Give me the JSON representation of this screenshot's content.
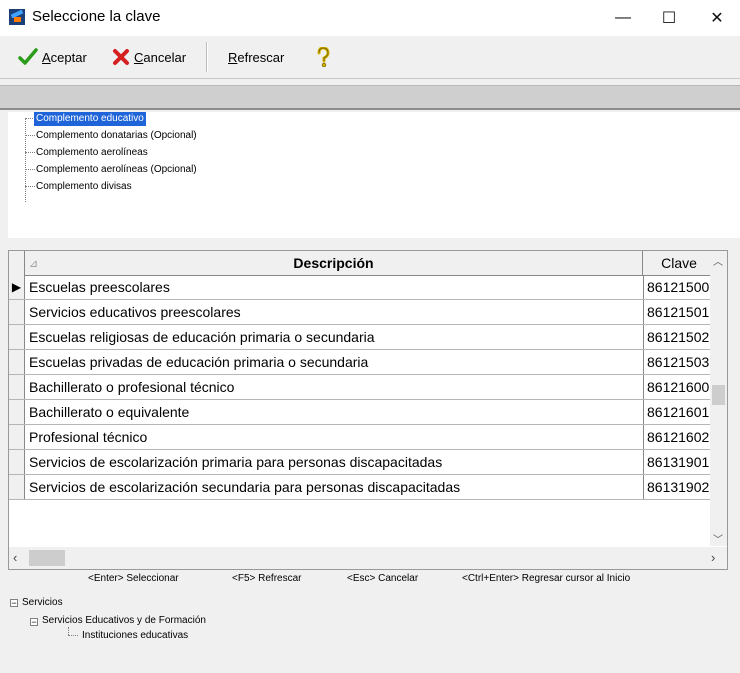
{
  "window": {
    "title": "Seleccione la clave",
    "minimize_glyph": "—",
    "maximize_glyph": "☐",
    "close_glyph": "✕"
  },
  "toolbar": {
    "accept": {
      "mnemonic": "A",
      "rest": "ceptar",
      "icon": "check-icon",
      "color": "#2a9c1a"
    },
    "cancel": {
      "mnemonic": "C",
      "rest": "ancelar",
      "icon": "x-icon",
      "color": "#d42020"
    },
    "refresh": {
      "mnemonic": "R",
      "rest": "efrescar"
    },
    "help_icon": "help-icon"
  },
  "complement_tree": {
    "items": [
      "Complemento educativo",
      "Complemento donatarias (Opcional)",
      "Complemento aerolíneas",
      "Complemento aerolíneas (Opcional)",
      "Complemento divisas"
    ],
    "selected_index": 0
  },
  "grid": {
    "headers": {
      "description": "Descripción",
      "clave": "Clave"
    },
    "current_row_marker": "▶",
    "rows": [
      {
        "description": "Escuelas preescolares",
        "clave": "86121500"
      },
      {
        "description": "Servicios educativos preescolares",
        "clave": "86121501"
      },
      {
        "description": "Escuelas religiosas de educación primaria o secundaria",
        "clave": "86121502"
      },
      {
        "description": "Escuelas privadas de educación primaria o secundaria",
        "clave": "86121503"
      },
      {
        "description": "Bachillerato o profesional técnico",
        "clave": "86121600"
      },
      {
        "description": "Bachillerato o equivalente",
        "clave": "86121601"
      },
      {
        "description": "Profesional técnico",
        "clave": "86121602"
      },
      {
        "description": "Servicios de escolarización primaria para personas discapacitadas",
        "clave": "86131901"
      },
      {
        "description": "Servicios de escolarización secundaria para personas discapacitadas",
        "clave": "86131902"
      }
    ]
  },
  "hints": [
    "<Enter> Seleccionar",
    "<F5> Refrescar",
    "<Esc> Cancelar",
    "<Ctrl+Enter> Regresar cursor al Inicio"
  ],
  "category_tree": {
    "level1": "Servicios",
    "level2": "Servicios Educativos y de Formación",
    "level3": "Instituciones educativas",
    "expanded_glyph": "−"
  }
}
